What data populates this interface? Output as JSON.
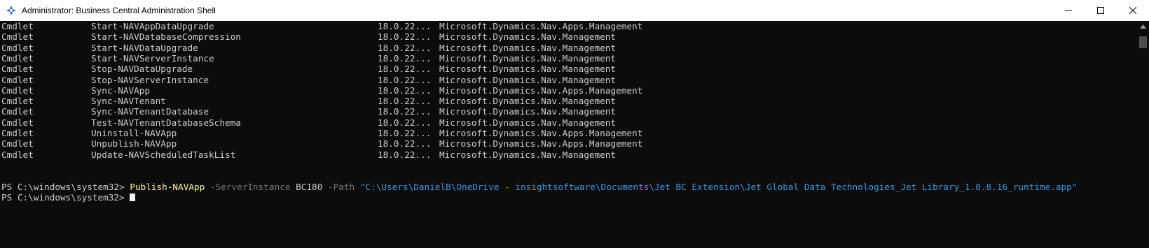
{
  "window": {
    "title": "Administrator: Business Central Administration Shell",
    "controls": {
      "minimize": "minimize-icon",
      "maximize": "maximize-icon",
      "close": "close-icon"
    }
  },
  "console": {
    "rows": [
      {
        "type": "Cmdlet",
        "name": "Start-NAVAppDataUpgrade",
        "version": "18.0.22...",
        "source": "Microsoft.Dynamics.Nav.Apps.Management"
      },
      {
        "type": "Cmdlet",
        "name": "Start-NAVDatabaseCompression",
        "version": "18.0.22...",
        "source": "Microsoft.Dynamics.Nav.Management"
      },
      {
        "type": "Cmdlet",
        "name": "Start-NAVDataUpgrade",
        "version": "18.0.22...",
        "source": "Microsoft.Dynamics.Nav.Management"
      },
      {
        "type": "Cmdlet",
        "name": "Start-NAVServerInstance",
        "version": "18.0.22...",
        "source": "Microsoft.Dynamics.Nav.Management"
      },
      {
        "type": "Cmdlet",
        "name": "Stop-NAVDataUpgrade",
        "version": "18.0.22...",
        "source": "Microsoft.Dynamics.Nav.Management"
      },
      {
        "type": "Cmdlet",
        "name": "Stop-NAVServerInstance",
        "version": "18.0.22...",
        "source": "Microsoft.Dynamics.Nav.Management"
      },
      {
        "type": "Cmdlet",
        "name": "Sync-NAVApp",
        "version": "18.0.22...",
        "source": "Microsoft.Dynamics.Nav.Apps.Management"
      },
      {
        "type": "Cmdlet",
        "name": "Sync-NAVTenant",
        "version": "18.0.22...",
        "source": "Microsoft.Dynamics.Nav.Management"
      },
      {
        "type": "Cmdlet",
        "name": "Sync-NAVTenantDatabase",
        "version": "18.0.22...",
        "source": "Microsoft.Dynamics.Nav.Management"
      },
      {
        "type": "Cmdlet",
        "name": "Test-NAVTenantDatabaseSchema",
        "version": "18.0.22...",
        "source": "Microsoft.Dynamics.Nav.Management"
      },
      {
        "type": "Cmdlet",
        "name": "Uninstall-NAVApp",
        "version": "18.0.22...",
        "source": "Microsoft.Dynamics.Nav.Apps.Management"
      },
      {
        "type": "Cmdlet",
        "name": "Unpublish-NAVApp",
        "version": "18.0.22...",
        "source": "Microsoft.Dynamics.Nav.Apps.Management"
      },
      {
        "type": "Cmdlet",
        "name": "Update-NAVScheduledTaskList",
        "version": "18.0.22...",
        "source": "Microsoft.Dynamics.Nav.Management"
      }
    ],
    "command_line": {
      "prompt": "PS C:\\windows\\system32> ",
      "command": "Publish-NAVApp",
      "param1": " -ServerInstance ",
      "value1": "BC180",
      "param2": " -Path ",
      "value2": "\"C:\\Users\\DanielB\\OneDrive - insightsoftware\\Documents\\Jet BC Extension\\Jet Global Data Technologies_Jet Library_1.0.8.16_runtime.app\""
    },
    "current_prompt": "PS C:\\windows\\system32> "
  },
  "colors": {
    "background": "#0c0c0c",
    "foreground": "#cccccc",
    "command": "#f9f1a5",
    "parameter": "#767676",
    "string": "#3a96dd"
  }
}
